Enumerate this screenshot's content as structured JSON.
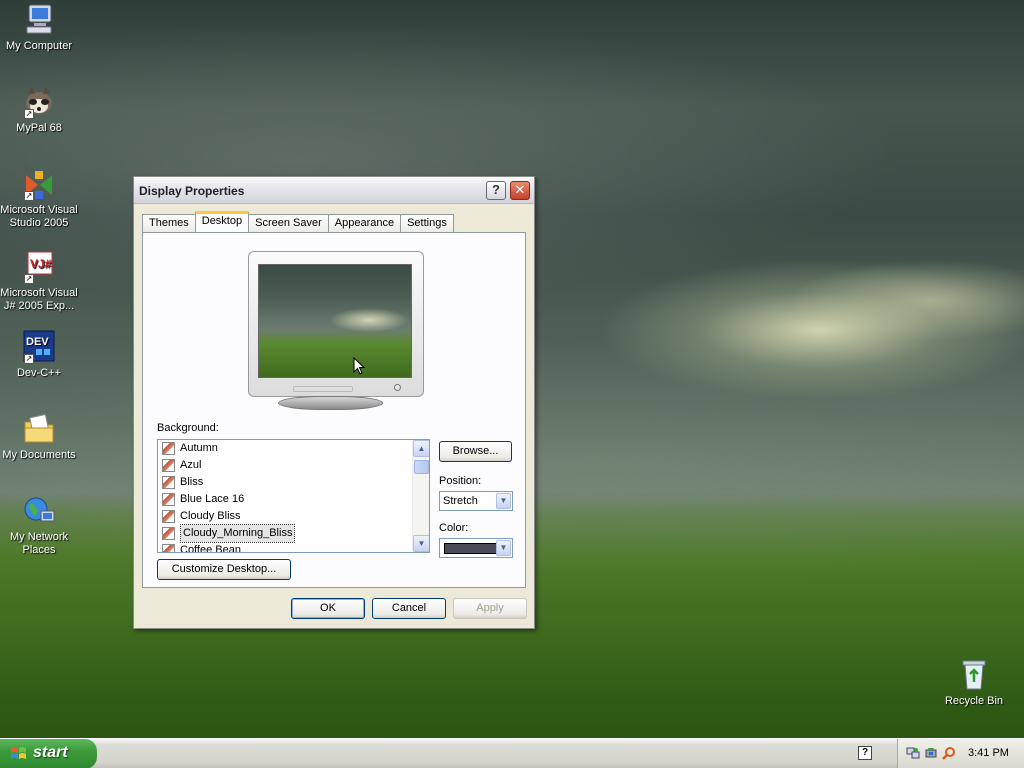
{
  "desktop": {
    "icons": [
      {
        "label": "My Computer"
      },
      {
        "label": "MyPal 68"
      },
      {
        "label": "Microsoft Visual Studio 2005"
      },
      {
        "label": "Microsoft Visual J# 2005 Exp..."
      },
      {
        "label": "Dev-C++"
      },
      {
        "label": "My Documents"
      },
      {
        "label": "My Network Places"
      },
      {
        "label": "Recycle Bin"
      }
    ]
  },
  "dialog": {
    "title": "Display Properties",
    "help_glyph": "?",
    "close_glyph": "✕",
    "tabs": [
      {
        "label": "Themes"
      },
      {
        "label": "Desktop",
        "active": true
      },
      {
        "label": "Screen Saver"
      },
      {
        "label": "Appearance"
      },
      {
        "label": "Settings"
      }
    ],
    "background_label": "Background:",
    "backgrounds": [
      {
        "name": "Autumn"
      },
      {
        "name": "Azul"
      },
      {
        "name": "Bliss"
      },
      {
        "name": "Blue Lace 16"
      },
      {
        "name": "Cloudy Bliss"
      },
      {
        "name": "Cloudy_Morning_Bliss",
        "selected": true
      },
      {
        "name": "Coffee Bean"
      }
    ],
    "browse_label": "Browse...",
    "position_label": "Position:",
    "position_value": "Stretch",
    "color_label": "Color:",
    "color_value": "#4a4a58",
    "customize_label": "Customize Desktop...",
    "ok_label": "OK",
    "cancel_label": "Cancel",
    "apply_label": "Apply"
  },
  "taskbar": {
    "start_label": "start",
    "clock": "3:41 PM"
  }
}
